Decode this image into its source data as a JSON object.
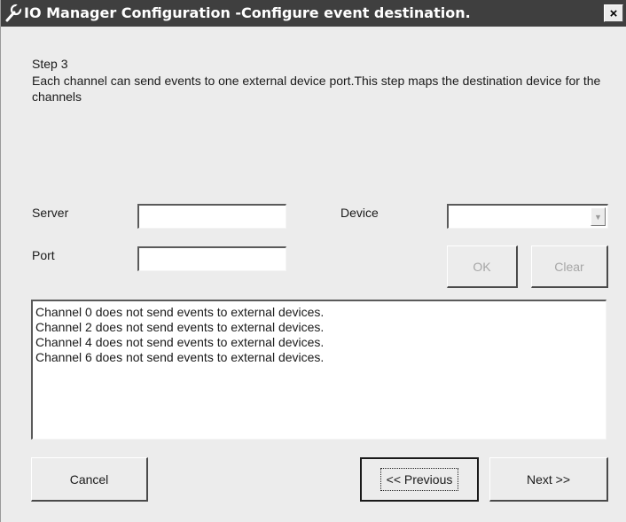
{
  "window": {
    "title": "IO Manager Configuration -Configure event destination.",
    "close_label": "×",
    "icon": "wrench-icon"
  },
  "intro": {
    "step": "Step 3",
    "description": "Each channel can send events to one external device port.This step maps the destination device for the channels"
  },
  "form": {
    "server_label": "Server",
    "server_value": "",
    "port_label": "Port",
    "port_value": "",
    "device_label": "Device",
    "device_value": "",
    "ok_label": "OK",
    "clear_label": "Clear"
  },
  "channels": [
    "Channel 0 does not send events to external devices.",
    "Channel 2 does not send events to external devices.",
    "Channel 4 does not send events to external devices.",
    "Channel 6 does not send events to external devices."
  ],
  "footer": {
    "cancel_label": "Cancel",
    "previous_label": "<< Previous",
    "next_label": "Next >>"
  }
}
